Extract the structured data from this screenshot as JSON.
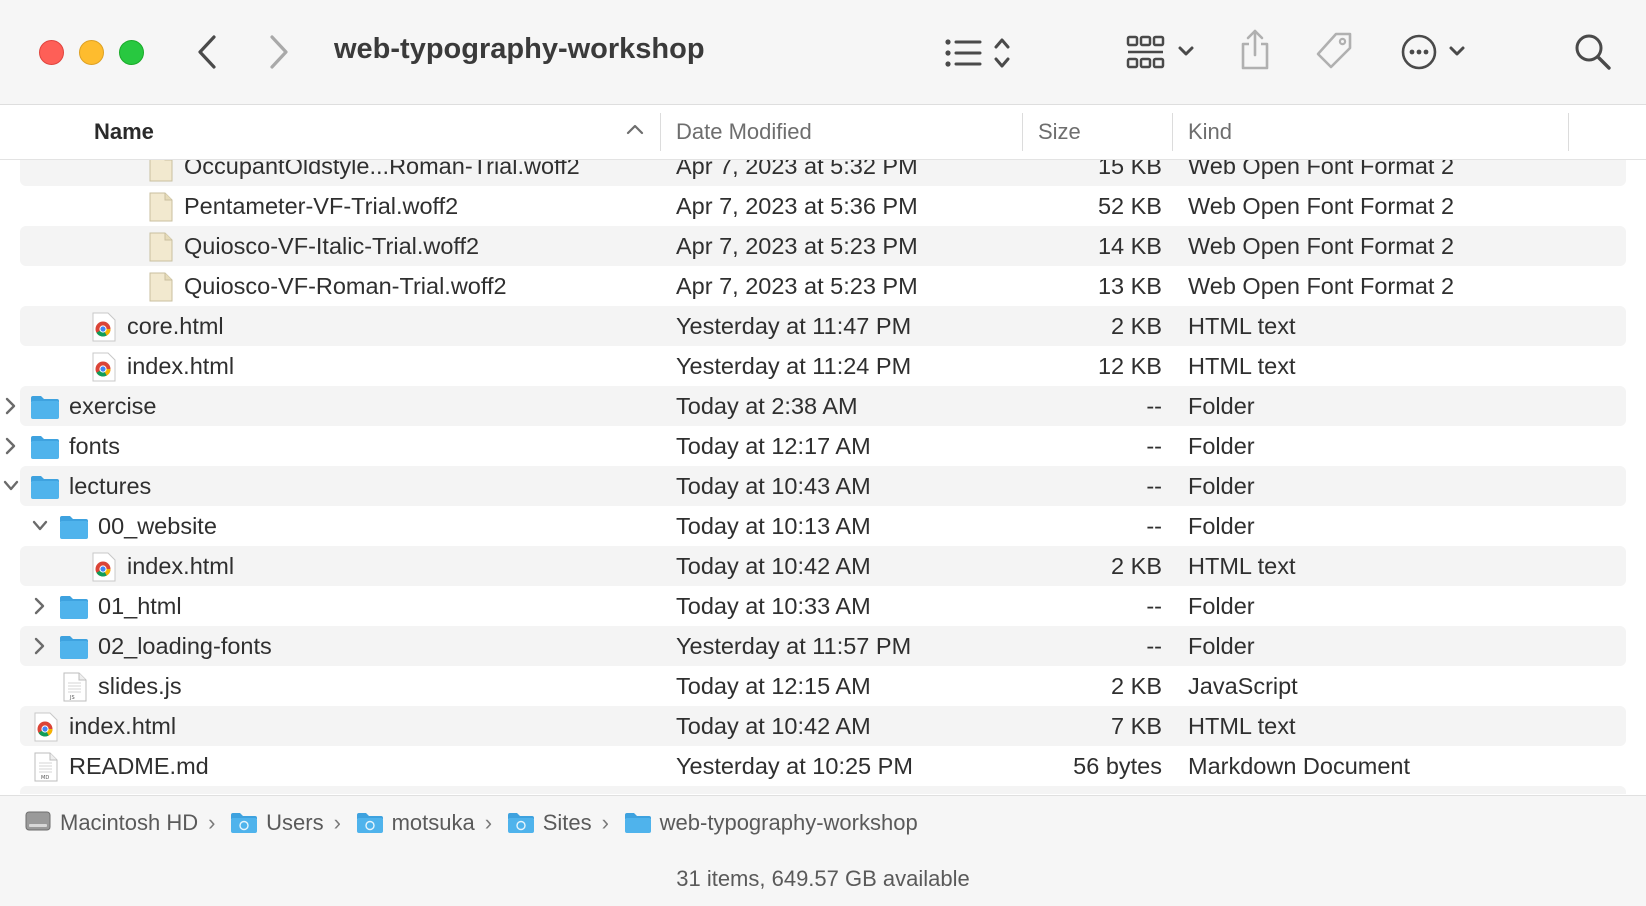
{
  "window": {
    "title": "web-typography-workshop"
  },
  "toolbar": {
    "back_icon": "chevron-left-icon",
    "forward_icon": "chevron-right-icon",
    "view_icon": "list-view-icon",
    "group_icon": "grid-icon",
    "share_icon": "share-icon",
    "tag_icon": "tag-icon",
    "more_icon": "ellipsis-circle-icon",
    "search_icon": "search-icon"
  },
  "columns": {
    "name": "Name",
    "date": "Date Modified",
    "size": "Size",
    "kind": "Kind"
  },
  "rows": [
    {
      "name": "OccupantOldstyle...Roman-Trial.woff2",
      "date": "Apr 7, 2023 at 5:32 PM",
      "size": "15 KB",
      "kind": "Web Open Font Format 2",
      "icon": "font-file-icon",
      "partial": true
    },
    {
      "name": "Pentameter-VF-Trial.woff2",
      "date": "Apr 7, 2023 at 5:36 PM",
      "size": "52 KB",
      "kind": "Web Open Font Format 2",
      "icon": "font-file-icon"
    },
    {
      "name": "Quiosco-VF-Italic-Trial.woff2",
      "date": "Apr 7, 2023 at 5:23 PM",
      "size": "14 KB",
      "kind": "Web Open Font Format 2",
      "icon": "font-file-icon"
    },
    {
      "name": "Quiosco-VF-Roman-Trial.woff2",
      "date": "Apr 7, 2023 at 5:23 PM",
      "size": "13 KB",
      "kind": "Web Open Font Format 2",
      "icon": "font-file-icon"
    },
    {
      "name": "core.html",
      "date": "Yesterday at 11:47 PM",
      "size": "2 KB",
      "kind": "HTML text",
      "icon": "chrome-html-icon"
    },
    {
      "name": "index.html",
      "date": "Yesterday at 11:24 PM",
      "size": "12 KB",
      "kind": "HTML text",
      "icon": "chrome-html-icon"
    },
    {
      "name": "exercise",
      "date": "Today at 2:38 AM",
      "size": "--",
      "kind": "Folder",
      "icon": "folder-icon",
      "disclosure": "collapsed"
    },
    {
      "name": "fonts",
      "date": "Today at 12:17 AM",
      "size": "--",
      "kind": "Folder",
      "icon": "folder-icon",
      "disclosure": "collapsed"
    },
    {
      "name": "lectures",
      "date": "Today at 10:43 AM",
      "size": "--",
      "kind": "Folder",
      "icon": "folder-icon",
      "disclosure": "expanded"
    },
    {
      "name": "00_website",
      "date": "Today at 10:13 AM",
      "size": "--",
      "kind": "Folder",
      "icon": "folder-icon",
      "disclosure": "expanded"
    },
    {
      "name": "index.html",
      "date": "Today at 10:42 AM",
      "size": "2 KB",
      "kind": "HTML text",
      "icon": "chrome-html-icon"
    },
    {
      "name": "01_html",
      "date": "Today at 10:33 AM",
      "size": "--",
      "kind": "Folder",
      "icon": "folder-icon",
      "disclosure": "collapsed"
    },
    {
      "name": "02_loading-fonts",
      "date": "Yesterday at 11:57 PM",
      "size": "--",
      "kind": "Folder",
      "icon": "folder-icon",
      "disclosure": "collapsed"
    },
    {
      "name": "slides.js",
      "date": "Today at 12:15 AM",
      "size": "2 KB",
      "kind": "JavaScript",
      "icon": "js-file-icon",
      "icon_label": "JS"
    },
    {
      "name": "index.html",
      "date": "Today at 10:42 AM",
      "size": "7 KB",
      "kind": "HTML text",
      "icon": "chrome-html-icon"
    },
    {
      "name": "README.md",
      "date": "Yesterday at 10:25 PM",
      "size": "56 bytes",
      "kind": "Markdown Document",
      "icon": "md-file-icon",
      "icon_label": "MD"
    }
  ],
  "pathbar": {
    "items": [
      {
        "label": "Macintosh HD",
        "icon": "hard-drive-icon"
      },
      {
        "label": "Users",
        "icon": "users-folder-icon"
      },
      {
        "label": "motsuka",
        "icon": "home-folder-icon"
      },
      {
        "label": "Sites",
        "icon": "sites-folder-icon"
      },
      {
        "label": "web-typography-workshop",
        "icon": "folder-icon"
      }
    ],
    "separator": "›"
  },
  "status": {
    "text": "31 items, 649.57 GB available"
  },
  "colors": {
    "close": "#fe5f57",
    "minimize": "#febc2e",
    "maximize": "#28c840",
    "folder": "#4fb3ec",
    "stripe": "#f4f4f4"
  }
}
